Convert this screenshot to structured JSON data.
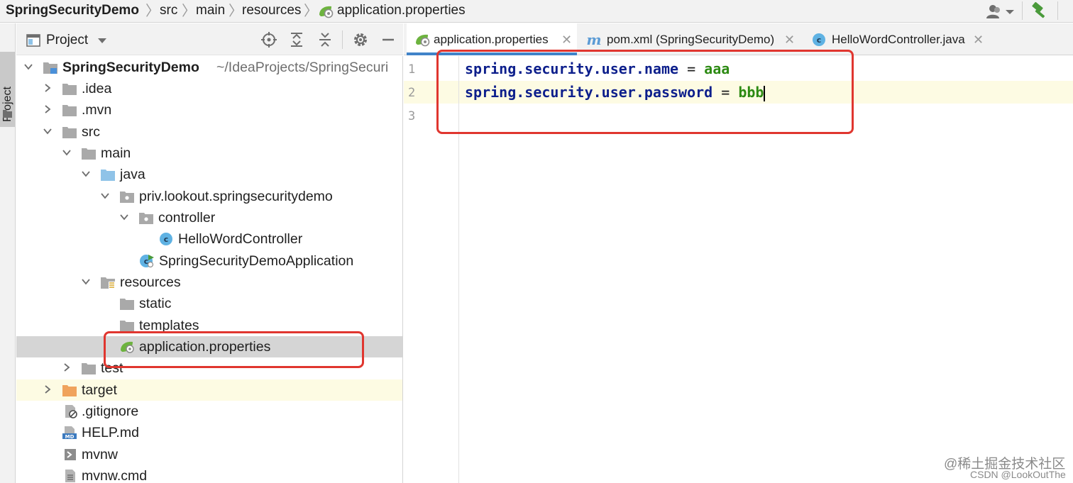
{
  "breadcrumbs": [
    "SpringSecurityDemo",
    "src",
    "main",
    "resources",
    "application.properties"
  ],
  "project_panel": {
    "title": "Project",
    "sidebar_label": "Project"
  },
  "tree": {
    "root": {
      "label": "SpringSecurityDemo",
      "path": "~/IdeaProjects/SpringSecuri"
    },
    "items": [
      "SpringSecurityDemo",
      ".idea",
      ".mvn",
      "src",
      "main",
      "java",
      "priv.lookout.springsecuritydemo",
      "controller",
      "HelloWordController",
      "SpringSecurityDemoApplication",
      "resources",
      "static",
      "templates",
      "application.properties",
      "test",
      "target",
      ".gitignore",
      "HELP.md",
      "mvnw",
      "mvnw.cmd"
    ]
  },
  "tabs": [
    {
      "label": "application.properties",
      "active": true
    },
    {
      "label": "pom.xml (SpringSecurityDemo)",
      "active": false
    },
    {
      "label": "HelloWordController.java",
      "active": false
    }
  ],
  "editor": {
    "line_numbers": [
      "1",
      "2",
      "3"
    ],
    "lines": [
      {
        "key": "spring.security.user.name",
        "eq": "=",
        "value": "aaa"
      },
      {
        "key": "spring.security.user.password",
        "eq": "=",
        "value": "bbb"
      }
    ]
  },
  "watermark": {
    "line1": "@稀土掘金技术社区",
    "line2": "CSDN @LookOutThe"
  },
  "colors": {
    "accent": "#4083c9",
    "annotation": "#e0362f",
    "property_key": "#0d1f8c",
    "property_value": "#2c8a12",
    "folder": "#a9a9a9",
    "target_folder": "#f0a35c",
    "source_folder": "#8fc3e8",
    "class_icon": "#5fb2e3",
    "spring_icon": "#6db33f"
  },
  "icons": [
    "spring-leaf-icon",
    "maven-icon",
    "class-icon",
    "folder-icon",
    "package-icon",
    "spring-boot-app-icon",
    "resources-folder-icon",
    "markdown-icon",
    "gitignore-icon",
    "mvnw-script-icon",
    "mvnw-cmd-icon",
    "locate-icon",
    "expand-all-icon",
    "collapse-all-icon",
    "gear-icon",
    "hide-icon",
    "user-menu-icon",
    "hammer-icon"
  ]
}
